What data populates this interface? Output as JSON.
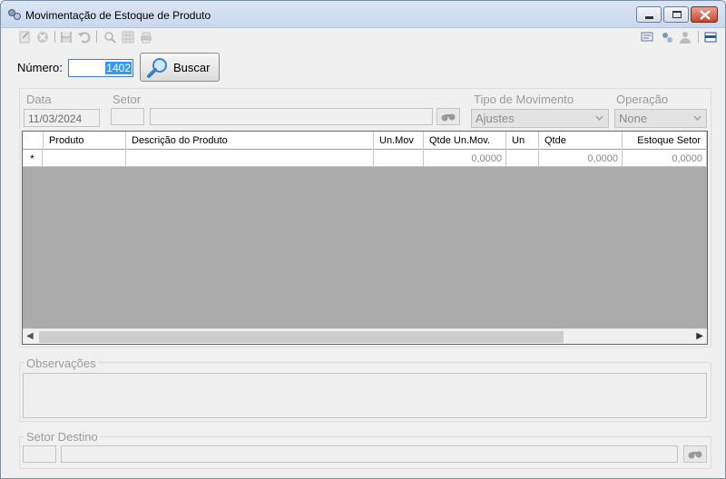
{
  "window": {
    "title": "Movimentação de Estoque de Produto"
  },
  "toolbar": {
    "left_icons": [
      "new-icon",
      "cancel-icon",
      "save-icon",
      "undo-icon",
      "search-icon",
      "grid-icon",
      "print-icon"
    ],
    "right_icons": [
      "print-preview-icon",
      "settings-icon",
      "user-icon",
      "menu-icon"
    ]
  },
  "search": {
    "numero_label": "Número:",
    "numero_value": "1402",
    "buscar_label": "Buscar"
  },
  "header": {
    "data_label": "Data",
    "data_value": "11/03/2024",
    "setor_label": "Setor",
    "tipo_label": "Tipo de Movimento",
    "tipo_value": "Ajustes",
    "operacao_label": "Operação",
    "operacao_value": "None"
  },
  "grid": {
    "columns": [
      "Produto",
      "Descrição do Produto",
      "Un.Mov",
      "Qtde Un.Mov.",
      "Un",
      "Qtde",
      "Estoque Setor"
    ],
    "new_row_marker": "*",
    "new_row_values": [
      "",
      "",
      "",
      "0,0000",
      "",
      "0,0000",
      "0,0000"
    ]
  },
  "observacoes": {
    "label": "Observações"
  },
  "setor_destino": {
    "label": "Setor Destino"
  },
  "colors": {
    "accent": "#3399ff",
    "grid_empty": "#ababab"
  }
}
